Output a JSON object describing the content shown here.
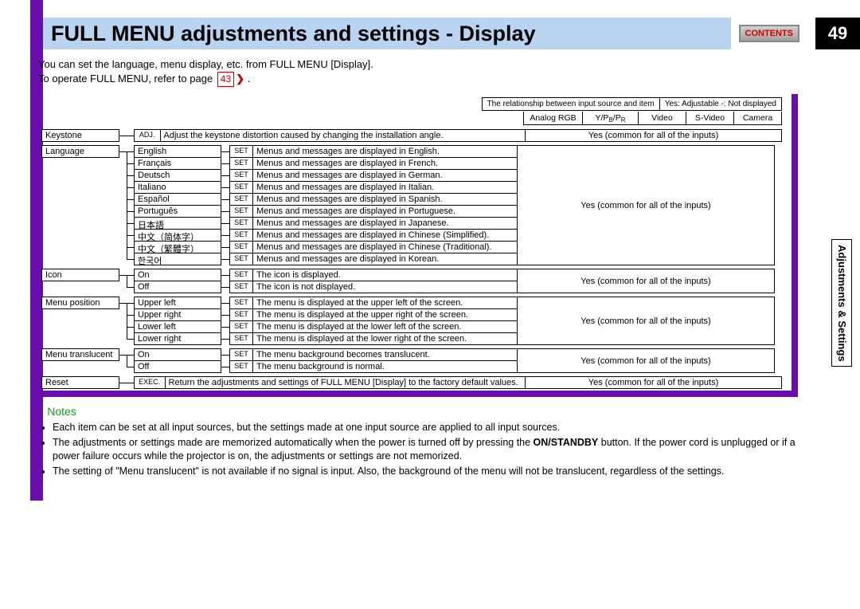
{
  "page_number": "49",
  "title": "FULL MENU adjustments and settings - Display",
  "contents_label": "CONTENTS",
  "intro_line1": "You can set the language, menu display, etc. from FULL MENU [Display].",
  "intro_line2_a": "To operate FULL MENU, refer to page ",
  "intro_page_ref": "43",
  "legend": {
    "left": "The relationship between input source and item",
    "right": "Yes: Adjustable    -: Not displayed"
  },
  "source_headers": [
    "Analog RGB",
    "Y/PB/PR",
    "Video",
    "S-Video",
    "Camera"
  ],
  "common_text": "Yes (common for all of the inputs)",
  "sections": {
    "keystone": {
      "name": "Keystone",
      "tag": "ADJ.",
      "desc": "Adjust the keystone distortion caused by changing the installation angle."
    },
    "language": {
      "name": "Language",
      "items": [
        {
          "opt": "English",
          "tag": "SET",
          "desc": "Menus and messages are displayed in English."
        },
        {
          "opt": "Français",
          "tag": "SET",
          "desc": "Menus and messages are displayed in French."
        },
        {
          "opt": "Deutsch",
          "tag": "SET",
          "desc": "Menus and messages are displayed in German."
        },
        {
          "opt": "Italiano",
          "tag": "SET",
          "desc": "Menus and messages are displayed in Italian."
        },
        {
          "opt": "Español",
          "tag": "SET",
          "desc": "Menus and messages are displayed in Spanish."
        },
        {
          "opt": "Português",
          "tag": "SET",
          "desc": "Menus and messages are displayed in Portuguese."
        },
        {
          "opt": "日本語",
          "tag": "SET",
          "desc": "Menus and messages are displayed in Japanese."
        },
        {
          "opt": "中文（简体字）",
          "tag": "SET",
          "desc": "Menus and messages are displayed in Chinese (Simplified)."
        },
        {
          "opt": "中文（繁體字）",
          "tag": "SET",
          "desc": "Menus and messages are displayed in Chinese (Traditional)."
        },
        {
          "opt": "한국어",
          "tag": "SET",
          "desc": "Menus and messages are displayed in Korean."
        }
      ]
    },
    "icon": {
      "name": "Icon",
      "items": [
        {
          "opt": "On",
          "tag": "SET",
          "desc": "The icon is displayed."
        },
        {
          "opt": "Off",
          "tag": "SET",
          "desc": "The icon is not displayed."
        }
      ]
    },
    "menu_position": {
      "name": "Menu position",
      "items": [
        {
          "opt": "Upper left",
          "tag": "SET",
          "desc": "The menu is displayed at the upper left of the screen."
        },
        {
          "opt": "Upper right",
          "tag": "SET",
          "desc": "The menu is displayed at the upper right of the screen."
        },
        {
          "opt": "Lower left",
          "tag": "SET",
          "desc": "The menu is displayed at the lower left of the screen."
        },
        {
          "opt": "Lower right",
          "tag": "SET",
          "desc": "The menu is displayed at the lower right of the screen."
        }
      ]
    },
    "menu_translucent": {
      "name": "Menu translucent",
      "items": [
        {
          "opt": "On",
          "tag": "SET",
          "desc": "The menu background becomes translucent."
        },
        {
          "opt": "Off",
          "tag": "SET",
          "desc": "The menu background is normal."
        }
      ]
    },
    "reset": {
      "name": "Reset",
      "tag": "EXEC.",
      "desc": "Return the adjustments and settings of FULL MENU [Display] to the factory default values."
    }
  },
  "notes": {
    "heading": "Notes",
    "items": [
      "Each item can be set at all input sources, but the settings made at one input source are applied to all input sources.",
      "The adjustments or settings made are memorized automatically when the power is turned off by pressing the ON/STANDBY button. If the power cord is unplugged or if a power failure occurs while the projector is on, the adjustments or settings are not memorized.",
      "The setting of \"Menu translucent\" is not available if no signal is input. Also, the background of the menu will not be translucent, regardless of the settings."
    ]
  },
  "side_tab": "Adjustments & Settings"
}
